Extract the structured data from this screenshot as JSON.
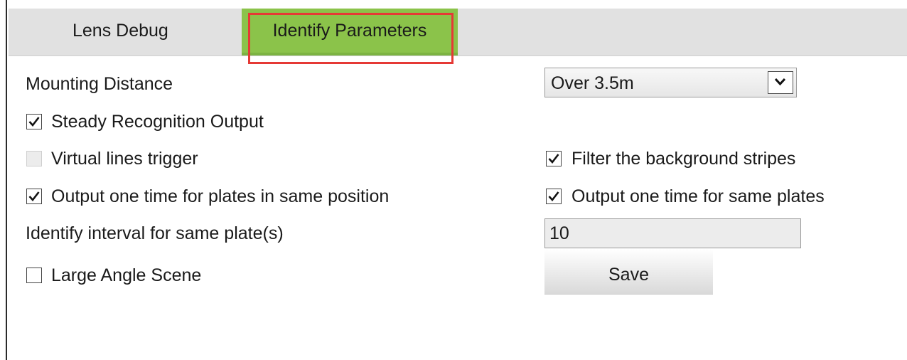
{
  "tabs": [
    {
      "label": "Lens Debug",
      "active": false
    },
    {
      "label": "Identify Parameters",
      "active": true
    }
  ],
  "fields": {
    "mounting_distance": {
      "label": "Mounting Distance",
      "value": "Over 3.5m"
    },
    "steady_output": {
      "label": "Steady Recognition Output",
      "checked": true
    },
    "virtual_lines": {
      "label": "Virtual lines trigger",
      "checked": false,
      "enabled": false
    },
    "filter_stripes": {
      "label": "Filter the background stripes",
      "checked": true
    },
    "output_same_position": {
      "label": "Output one time for plates in same position",
      "checked": true
    },
    "output_same_plates": {
      "label": "Output one time for same plates",
      "checked": true
    },
    "identify_interval": {
      "label": "Identify interval for same plate(s)",
      "value": "10"
    },
    "large_angle": {
      "label": "Large Angle Scene",
      "checked": false
    }
  },
  "buttons": {
    "save": "Save"
  },
  "colors": {
    "active_tab": "#8bc34a",
    "highlight": "#e53935",
    "tabbar": "#e1e1e1"
  },
  "icons": {
    "checkmark": "checkmark-icon",
    "dropdown": "chevron-down-icon"
  }
}
